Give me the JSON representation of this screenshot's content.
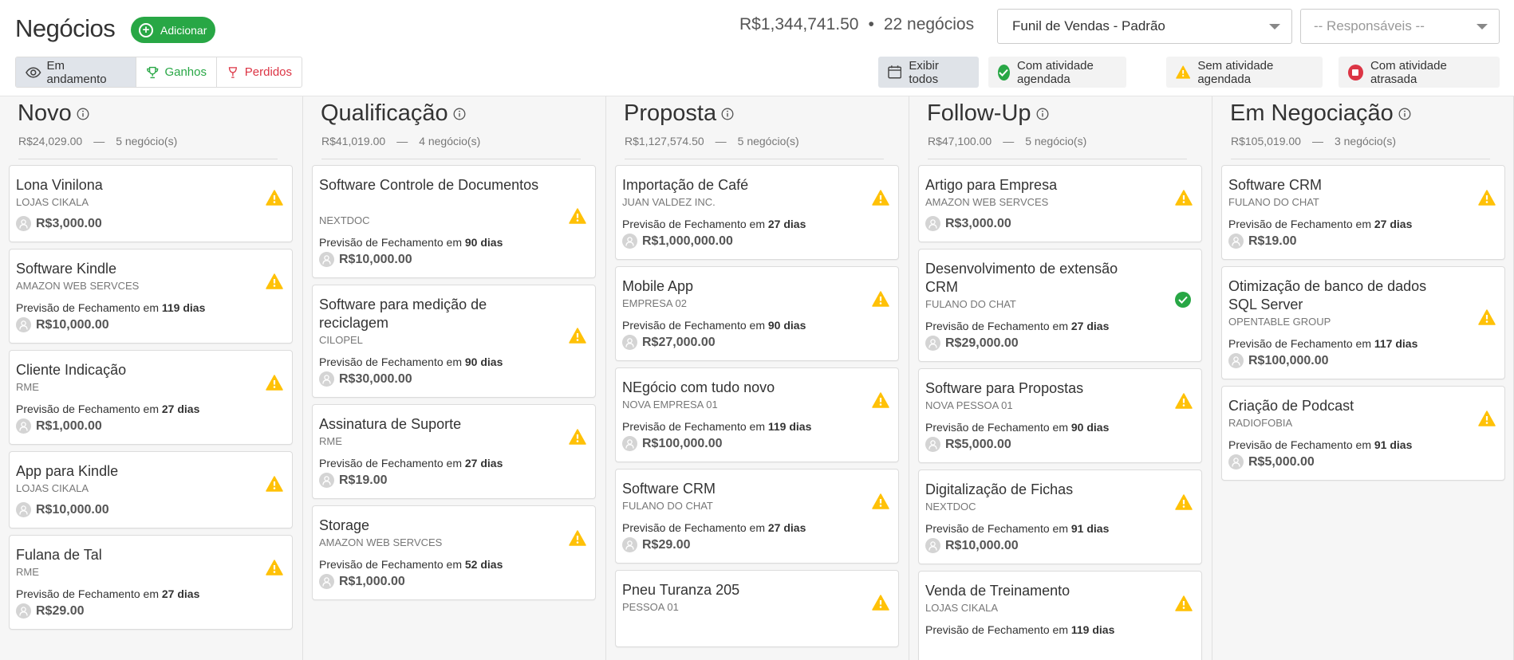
{
  "header": {
    "title": "Negócios",
    "add_label": "Adicionar",
    "total_value": "R$1,344,741.50",
    "separator": "•",
    "total_count": "22 negócios",
    "funnel_select": "Funil de Vendas - Padrão",
    "responsible_select": "-- Responsáveis --"
  },
  "status_tabs": {
    "in_progress": "Em andamento",
    "won": "Ganhos",
    "lost": "Perdidos"
  },
  "filters": {
    "show_all": "Exibir todos",
    "scheduled": "Com atividade agendada",
    "not_scheduled": "Sem atividade agendada",
    "overdue": "Com atividade atrasada"
  },
  "colors": {
    "green": "#28a745",
    "warning": "#ffc107",
    "red": "#dc3545"
  },
  "forecast_prefix": "Previsão de Fechamento em",
  "columns": [
    {
      "title": "Novo",
      "total": "R$24,029.00",
      "dash": "—",
      "count": "5 negócio(s)",
      "cards": [
        {
          "title": "Lona Vinilona",
          "company": "LOJAS CIKALA",
          "forecast": "",
          "value": "R$3,000.00",
          "status": "warning"
        },
        {
          "title": "Software Kindle",
          "company": "AMAZON WEB SERVCES",
          "forecast": "119 dias",
          "value": "R$10,000.00",
          "status": "warning"
        },
        {
          "title": "Cliente Indicação",
          "company": "RME",
          "forecast": "27 dias",
          "value": "R$1,000.00",
          "status": "warning"
        },
        {
          "title": "App para Kindle",
          "company": "LOJAS CIKALA",
          "forecast": "",
          "value": "R$10,000.00",
          "status": "warning"
        },
        {
          "title": "Fulana de Tal",
          "company": "RME",
          "forecast": "27 dias",
          "value": "R$29.00",
          "status": "warning"
        }
      ]
    },
    {
      "title": "Qualificação",
      "total": "R$41,019.00",
      "dash": "—",
      "count": "4 negócio(s)",
      "cards": [
        {
          "title": "Software Controle de Documentos",
          "company": "NEXTDOC",
          "forecast": "90 dias",
          "value": "R$10,000.00",
          "status": "warning"
        },
        {
          "title": "Software para medição de reciclagem",
          "company": "CILOPEL",
          "forecast": "90 dias",
          "value": "R$30,000.00",
          "status": "warning"
        },
        {
          "title": "Assinatura de Suporte",
          "company": "RME",
          "forecast": "27 dias",
          "value": "R$19.00",
          "status": "warning"
        },
        {
          "title": "Storage",
          "company": "AMAZON WEB SERVCES",
          "forecast": "52 dias",
          "value": "R$1,000.00",
          "status": "warning"
        }
      ]
    },
    {
      "title": "Proposta",
      "total": "R$1,127,574.50",
      "dash": "—",
      "count": "5 negócio(s)",
      "cards": [
        {
          "title": "Importação de Café",
          "company": "JUAN VALDEZ INC.",
          "forecast": "27 dias",
          "value": "R$1,000,000.00",
          "status": "warning"
        },
        {
          "title": "Mobile App",
          "company": "EMPRESA 02",
          "forecast": "90 dias",
          "value": "R$27,000.00",
          "status": "warning"
        },
        {
          "title": "NEgócio com tudo novo",
          "company": "NOVA EMPRESA 01",
          "forecast": "119 dias",
          "value": "R$100,000.00",
          "status": "warning"
        },
        {
          "title": "Software CRM",
          "company": "FULANO DO CHAT",
          "forecast": "27 dias",
          "value": "R$29.00",
          "status": "warning"
        },
        {
          "title": "Pneu Turanza 205",
          "company": "PESSOA 01",
          "forecast": "",
          "value": "",
          "status": "warning"
        }
      ]
    },
    {
      "title": "Follow-Up",
      "total": "R$47,100.00",
      "dash": "—",
      "count": "5 negócio(s)",
      "cards": [
        {
          "title": "Artigo para Empresa",
          "company": "AMAZON WEB SERVCES",
          "forecast": "",
          "value": "R$3,000.00",
          "status": "warning"
        },
        {
          "title": "Desenvolvimento de extensão CRM",
          "company": "FULANO DO CHAT",
          "forecast": "27 dias",
          "value": "R$29,000.00",
          "status": "scheduled"
        },
        {
          "title": "Software para Propostas",
          "company": "NOVA PESSOA 01",
          "forecast": "90 dias",
          "value": "R$5,000.00",
          "status": "warning"
        },
        {
          "title": "Digitalização de Fichas",
          "company": "NEXTDOC",
          "forecast": "91 dias",
          "value": "R$10,000.00",
          "status": "warning"
        },
        {
          "title": "Venda de Treinamento",
          "company": "LOJAS CIKALA",
          "forecast": "119 dias",
          "value": "",
          "status": "warning"
        }
      ]
    },
    {
      "title": "Em Negociação",
      "total": "R$105,019.00",
      "dash": "—",
      "count": "3 negócio(s)",
      "cards": [
        {
          "title": "Software CRM",
          "company": "FULANO DO CHAT",
          "forecast": "27 dias",
          "value": "R$19.00",
          "status": "warning"
        },
        {
          "title": "Otimização de banco de dados SQL Server",
          "company": "OPENTABLE GROUP",
          "forecast": "117 dias",
          "value": "R$100,000.00",
          "status": "warning"
        },
        {
          "title": "Criação de Podcast",
          "company": "RADIOFOBIA",
          "forecast": "91 dias",
          "value": "R$5,000.00",
          "status": "warning"
        }
      ]
    }
  ]
}
